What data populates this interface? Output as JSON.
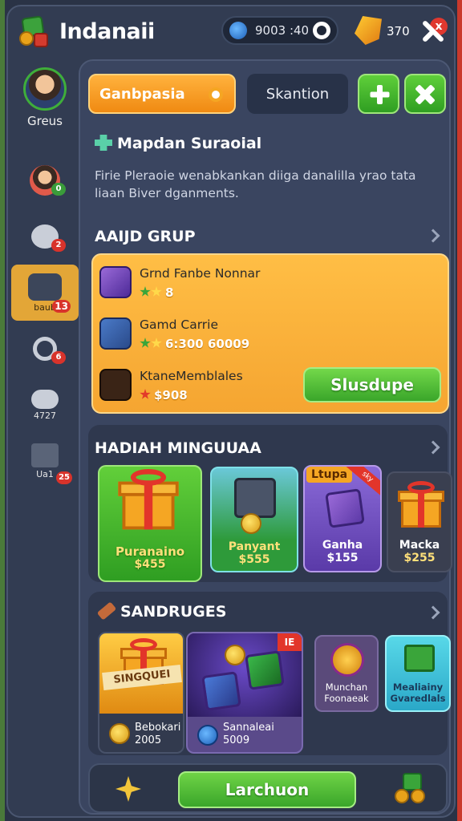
{
  "topbar": {
    "title": "Indanaii",
    "coins": "9003 :40",
    "gems": "370",
    "close_badge": "x"
  },
  "sidebar": {
    "profile_name": "Greus",
    "items": [
      {
        "label": "",
        "badge": "0"
      },
      {
        "label": "",
        "badge": "2"
      },
      {
        "label": "baub",
        "badge": "13"
      },
      {
        "label": "",
        "badge": "6"
      },
      {
        "label": "4727",
        "badge": ""
      },
      {
        "label": "Ua1",
        "badge": "25"
      }
    ]
  },
  "tabs": {
    "primary": "Ganbpasia",
    "secondary": "Skantion"
  },
  "intro": {
    "title": "Mapdan Suraoial",
    "description": "Firie Pleraoie wenabkankan diiga danalilla yrao tata liaan Biver dganments."
  },
  "group": {
    "title": "AAIJD GRUP",
    "rows": [
      {
        "name": "Grnd Fanbe Nonnar",
        "meta": "8"
      },
      {
        "name": "Gamd Carrie",
        "meta": "6:300 60009"
      },
      {
        "name": "KtaneMemblales",
        "meta": "$908"
      }
    ],
    "action": "Slusdupe"
  },
  "weekly": {
    "title": "HADIAH MINGUUAA",
    "tiles": [
      {
        "name": "Puranaino",
        "price": "$455"
      },
      {
        "name": "Panyant",
        "price": "$555"
      },
      {
        "name": "Ganha",
        "price": "$155",
        "tag": "Ltupa",
        "ribbon": "sky"
      },
      {
        "name": "Macka",
        "price": "$255"
      }
    ]
  },
  "sandruges": {
    "title": "SANDRUGES",
    "tiles": [
      {
        "banner": "SINGQUEI",
        "name": "Bebokari",
        "value": "2005"
      },
      {
        "name": "Sannaleai",
        "value": "5009",
        "ribbon": "IE"
      },
      {
        "name": "Munchan Foonaeak"
      },
      {
        "name": "Mealiainy Gvaredlals"
      }
    ]
  },
  "footer": {
    "launch": "Larchuon"
  }
}
